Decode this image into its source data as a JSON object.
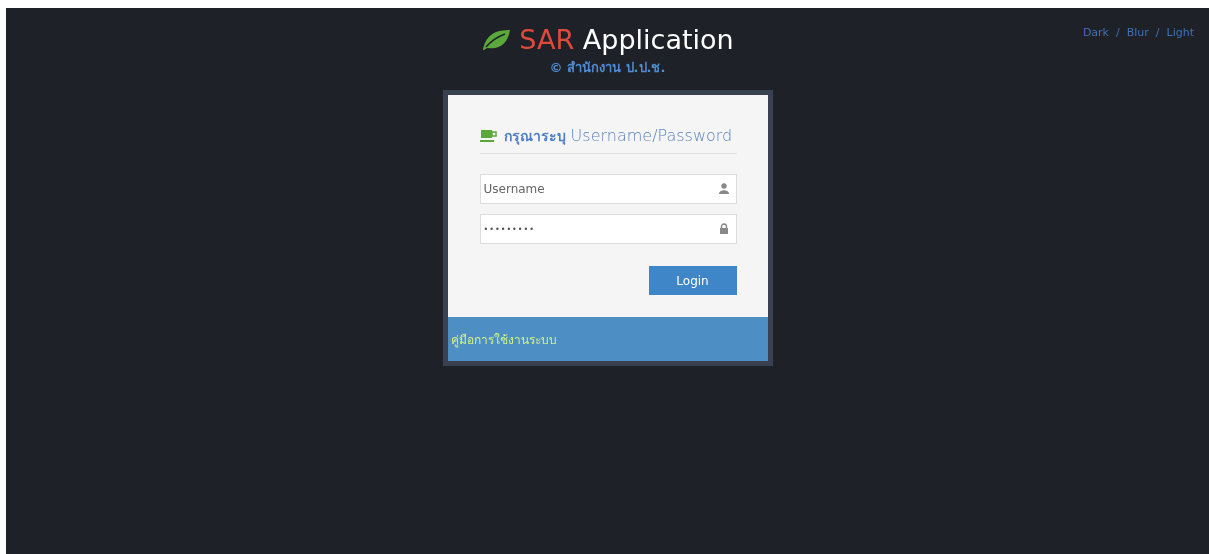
{
  "header": {
    "brand": "SAR",
    "title": "Application",
    "subtitle": "© สำนักงาน ป.ป.ช."
  },
  "theme_links": {
    "separator": "/",
    "items": [
      {
        "label": "Dark"
      },
      {
        "label": "Blur"
      },
      {
        "label": "Light"
      }
    ]
  },
  "login_card": {
    "heading": "**กรุณาระบุ** Username/Password",
    "fields": [
      {
        "kind": "text",
        "placeholder": "Username"
      },
      {
        "kind": "password",
        "value": "•••••••••"
      }
    ],
    "button": "Login",
    "footer_link": "คู่มือการใช้งานระบบ"
  }
}
